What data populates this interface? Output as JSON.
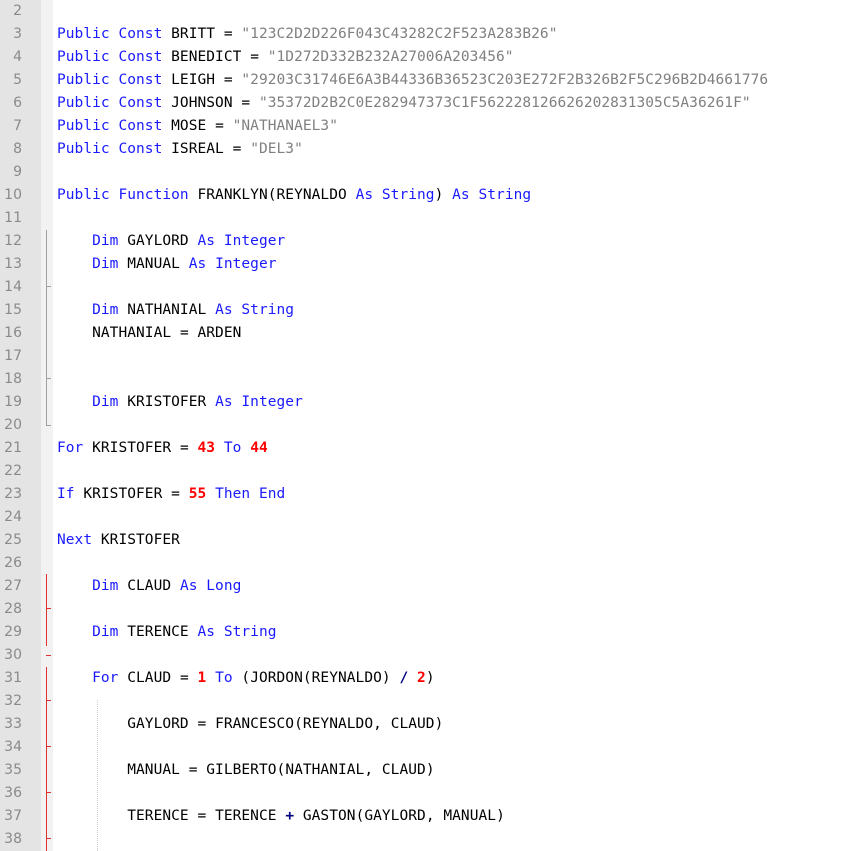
{
  "lines": [
    {
      "n": "2",
      "code": ""
    },
    {
      "n": "3",
      "code": "Public Const BRITT = \"123C2D2D226F043C43282C2F523A283B26\""
    },
    {
      "n": "4",
      "code": "Public Const BENEDICT = \"1D272D332B232A27006A203456\""
    },
    {
      "n": "5",
      "code": "Public Const LEIGH = \"29203C31746E6A3B44336B36523C203E272F2B326B2F5C296B2D4661776"
    },
    {
      "n": "6",
      "code": "Public Const JOHNSON = \"35372D2B2C0E282947373C1F562228126626202831305C5A36261F\""
    },
    {
      "n": "7",
      "code": "Public Const MOSE = \"NATHANAEL3\""
    },
    {
      "n": "8",
      "code": "Public Const ISREAL = \"DEL3\""
    },
    {
      "n": "9",
      "code": ""
    },
    {
      "n": "10",
      "code": "Public Function FRANKLYN(REYNALDO As String) As String"
    },
    {
      "n": "11",
      "code": ""
    },
    {
      "n": "12",
      "code": "    Dim GAYLORD As Integer"
    },
    {
      "n": "13",
      "code": "    Dim MANUAL As Integer"
    },
    {
      "n": "14",
      "code": ""
    },
    {
      "n": "15",
      "code": "    Dim NATHANIAL As String"
    },
    {
      "n": "16",
      "code": "    NATHANIAL = ARDEN"
    },
    {
      "n": "17",
      "code": ""
    },
    {
      "n": "18",
      "code": ""
    },
    {
      "n": "19",
      "code": "    Dim KRISTOFER As Integer"
    },
    {
      "n": "20",
      "code": ""
    },
    {
      "n": "21",
      "code": "For KRISTOFER = 43 To 44"
    },
    {
      "n": "22",
      "code": ""
    },
    {
      "n": "23",
      "code": "If KRISTOFER = 55 Then End"
    },
    {
      "n": "24",
      "code": ""
    },
    {
      "n": "25",
      "code": "Next KRISTOFER"
    },
    {
      "n": "26",
      "code": ""
    },
    {
      "n": "27",
      "code": "    Dim CLAUD As Long"
    },
    {
      "n": "28",
      "code": ""
    },
    {
      "n": "29",
      "code": "    Dim TERENCE As String"
    },
    {
      "n": "30",
      "code": ""
    },
    {
      "n": "31",
      "code": "    For CLAUD = 1 To (JORDON(REYNALDO) / 2)"
    },
    {
      "n": "32",
      "code": ""
    },
    {
      "n": "33",
      "code": "        GAYLORD = FRANCESCO(REYNALDO, CLAUD)"
    },
    {
      "n": "34",
      "code": ""
    },
    {
      "n": "35",
      "code": "        MANUAL = GILBERTO(NATHANIAL, CLAUD)"
    },
    {
      "n": "36",
      "code": ""
    },
    {
      "n": "37",
      "code": "        TERENCE = TERENCE + GASTON(GAYLORD, MANUAL)"
    },
    {
      "n": "38",
      "code": ""
    }
  ],
  "colors": {
    "keyword": "#1a1aff",
    "string": "#808080",
    "number": "#ff0000",
    "operator": "#000080",
    "text": "#000000",
    "gutter": "#e4e4e4",
    "fold_changed": "#e03030"
  }
}
